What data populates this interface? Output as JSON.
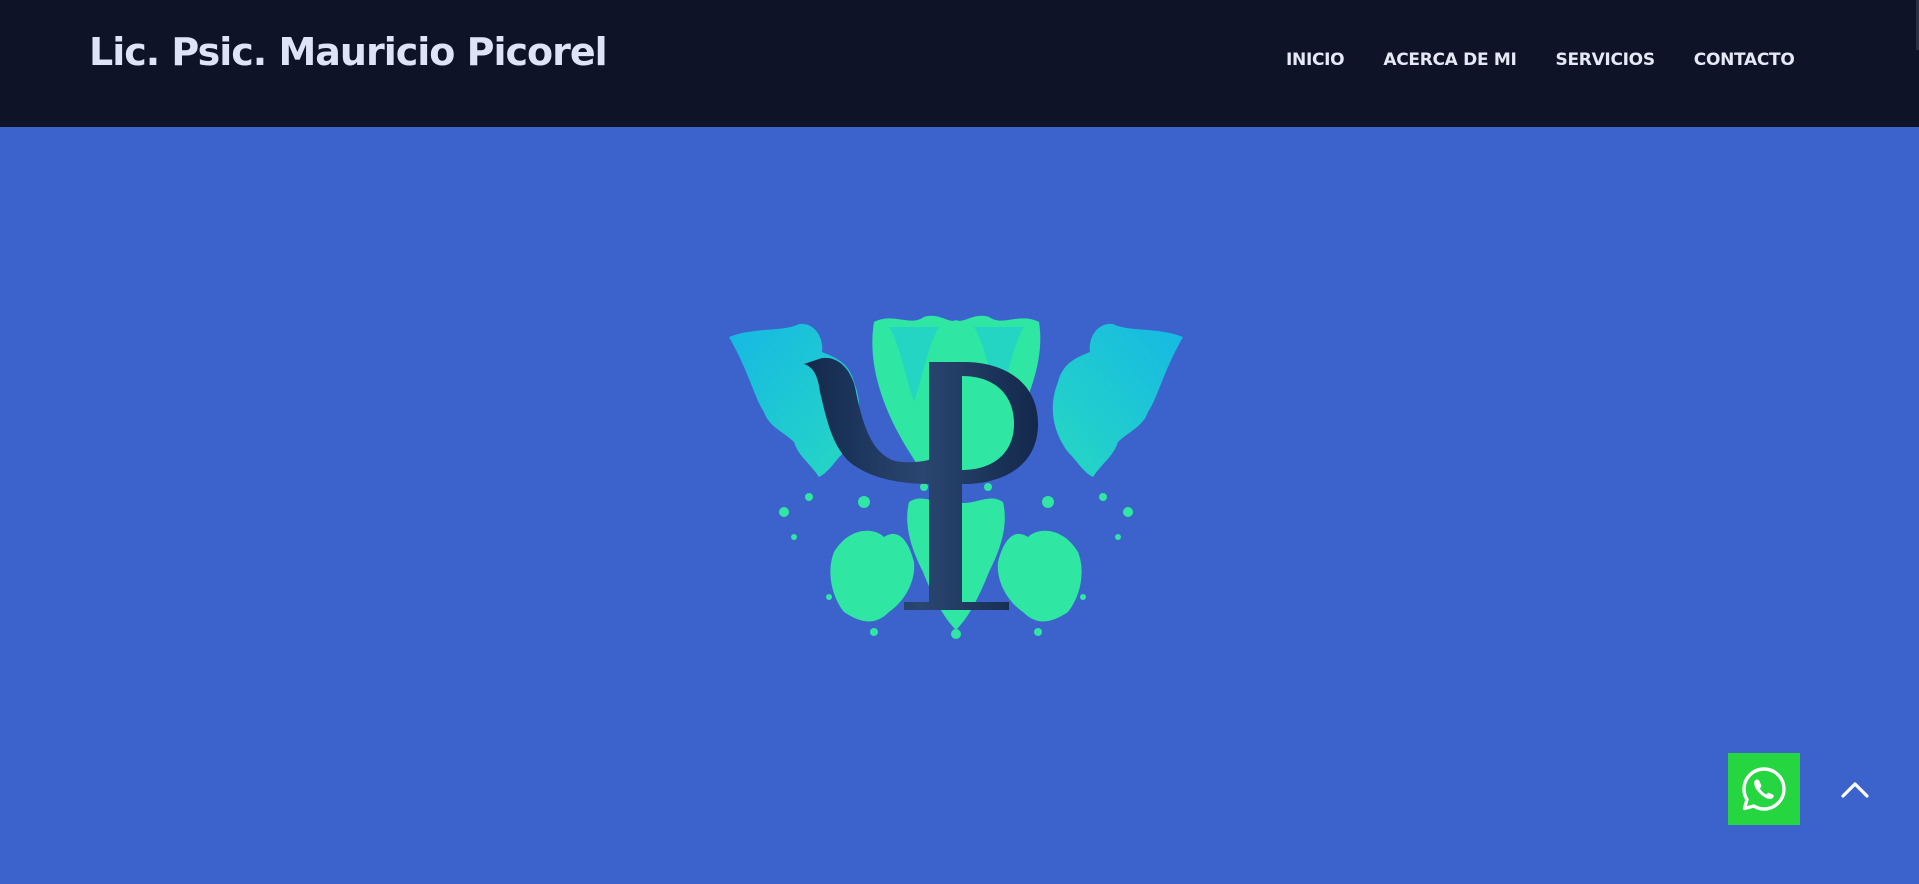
{
  "header": {
    "brand": "Lic. Psic. Mauricio Picorel",
    "nav": [
      {
        "label": "INICIO"
      },
      {
        "label": "ACERCA DE MI"
      },
      {
        "label": "SERVICIOS"
      },
      {
        "label": "CONTACTO"
      }
    ]
  },
  "hero": {
    "logo_icon": "psi-symbol-inkblot-logo"
  },
  "floating": {
    "whatsapp_icon": "whatsapp-icon",
    "scroll_top_icon": "chevron-up-icon"
  },
  "colors": {
    "header_bg": "#0e1328",
    "page_bg": "#3c62cc",
    "whatsapp_green": "#25d641",
    "inkblot_teal": "#1ec9d8",
    "inkblot_green": "#2fe6a2",
    "psi_navy": "#1d3458"
  }
}
